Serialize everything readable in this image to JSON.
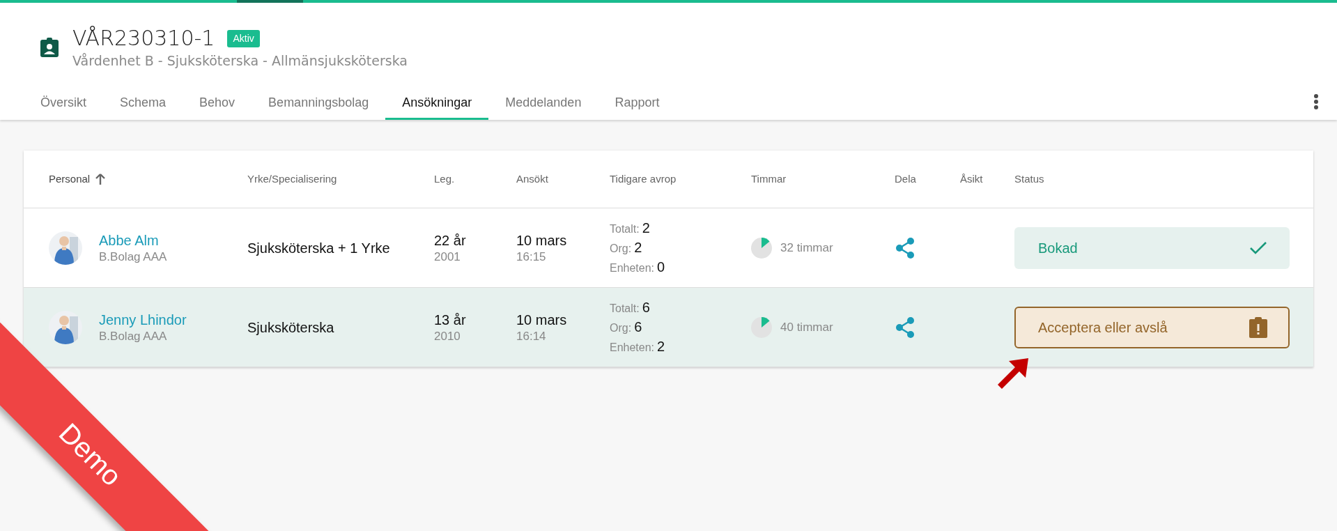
{
  "header": {
    "title": "VÅR230310-1",
    "badge": "Aktiv",
    "subtitle": "Vårdenhet B - Sjuksköterska - Allmänsjuksköterska"
  },
  "tabs": [
    {
      "label": "Översikt",
      "selected": false
    },
    {
      "label": "Schema",
      "selected": false
    },
    {
      "label": "Behov",
      "selected": false
    },
    {
      "label": "Bemanningsbolag",
      "selected": false
    },
    {
      "label": "Ansökningar",
      "selected": true
    },
    {
      "label": "Meddelanden",
      "selected": false
    },
    {
      "label": "Rapport",
      "selected": false
    }
  ],
  "table": {
    "columns": [
      {
        "label": "Personal",
        "sorted": true
      },
      {
        "label": "Yrke/Specialisering",
        "sorted": false
      },
      {
        "label": "Leg.",
        "sorted": false
      },
      {
        "label": "Ansökt",
        "sorted": false
      },
      {
        "label": "Tidigare avrop",
        "sorted": false
      },
      {
        "label": "Timmar",
        "sorted": false
      },
      {
        "label": "Dela",
        "sorted": false
      },
      {
        "label": "Åsikt",
        "sorted": false
      },
      {
        "label": "Status",
        "sorted": false
      }
    ],
    "rows": [
      {
        "selected": false,
        "name": "Abbe Alm",
        "company": "B.Bolag AAA",
        "profession": "Sjuksköterska + 1 Yrke",
        "leg_years": "22 år",
        "leg_year": "2001",
        "applied_date": "10 mars",
        "applied_time": "16:15",
        "previous": [
          {
            "label": "Totalt:",
            "value": "2"
          },
          {
            "label": "Org:",
            "value": "2"
          },
          {
            "label": "Enheten:",
            "value": "0"
          }
        ],
        "hours": "32 timmar",
        "status": {
          "kind": "booked",
          "label": "Bokad"
        }
      },
      {
        "selected": true,
        "name": "Jenny Lhindor",
        "company": "B.Bolag AAA",
        "profession": "Sjuksköterska",
        "leg_years": "13 år",
        "leg_year": "2010",
        "applied_date": "10 mars",
        "applied_time": "16:14",
        "previous": [
          {
            "label": "Totalt:",
            "value": "6"
          },
          {
            "label": "Org:",
            "value": "6"
          },
          {
            "label": "Enheten:",
            "value": "2"
          }
        ],
        "hours": "40 timmar",
        "status": {
          "kind": "action",
          "label": "Acceptera eller avslå"
        }
      }
    ]
  },
  "ribbon": {
    "label": "Demo"
  }
}
